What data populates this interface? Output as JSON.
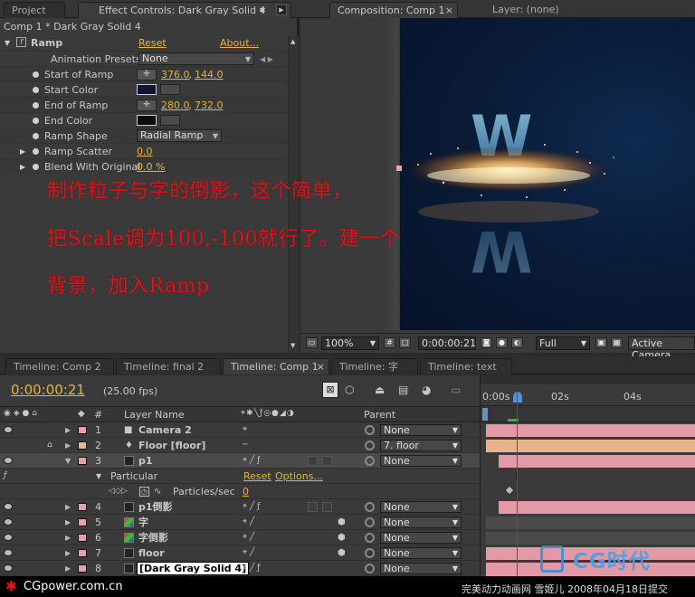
{
  "top_tabs": {
    "project": "Project",
    "effect_controls": "Effect Controls: Dark Gray Solid 4",
    "composition": "Composition: Comp 1",
    "layer": "Layer: (none)"
  },
  "effect_controls": {
    "breadcrumb": "Comp 1 * Dark Gray Solid 4",
    "effect_name": "Ramp",
    "reset": "Reset",
    "about": "About...",
    "presets_label": "Animation Presets:",
    "presets_value": "None",
    "props": [
      {
        "label": "Start of Ramp",
        "value_a": "376.0",
        "sep": " , ",
        "value_b": "144.0"
      },
      {
        "label": "Start Color"
      },
      {
        "label": "End of Ramp",
        "value_a": "280.0",
        "sep": " , ",
        "value_b": "732.0"
      },
      {
        "label": "End Color"
      },
      {
        "label": "Ramp Shape",
        "dropdown": "Radial Ramp"
      },
      {
        "label": "Ramp Scatter",
        "value": "0.0"
      },
      {
        "label": "Blend With Original",
        "value": "0.0 %"
      }
    ]
  },
  "overlay": {
    "line1": "制作粒子与字的倒影，这个简单，",
    "line2": "把Scale调为100,-100就行了。建一个",
    "line3": "背景，加入Ramp"
  },
  "viewer": {
    "zoom": "100%",
    "timecode": "0:00:00:21",
    "resolution": "Full",
    "camera": "Active Camera",
    "canvas_letter": "W"
  },
  "timeline_tabs": [
    "Timeline: Comp 2",
    "Timeline: final 2",
    "Timeline: Comp 1",
    "Timeline: 字",
    "Timeline: text"
  ],
  "timeline": {
    "timecode": "0:00:00:21",
    "fps": "(25.00 fps)",
    "col_num": "#",
    "col_layer": "Layer Name",
    "col_parent": "Parent",
    "ruler": [
      "0:00s",
      "02s",
      "04s"
    ],
    "layers": [
      {
        "num": "1",
        "name": "Camera 2",
        "parent": "None",
        "color": "#e6a0a8"
      },
      {
        "num": "2",
        "name": "Floor [floor]",
        "parent": "7. floor",
        "color": "#e8b68c"
      },
      {
        "num": "3",
        "name": "p1",
        "parent": "None",
        "color": "#e6a0a8"
      },
      {
        "num": "4",
        "name": "p1倒影",
        "parent": "None",
        "color": "#e6a0a8"
      },
      {
        "num": "5",
        "name": "字",
        "parent": "None",
        "color": "#e6a0a8"
      },
      {
        "num": "6",
        "name": "字倒影",
        "parent": "None",
        "color": "#e6a0a8"
      },
      {
        "num": "7",
        "name": "floor",
        "parent": "None",
        "color": "#e6a0a8"
      },
      {
        "num": "8",
        "name": "[Dark Gray Solid 4]",
        "parent": "None",
        "color": "#e6a0a8"
      }
    ],
    "sub_effect": "Particular",
    "sub_reset": "Reset",
    "sub_options": "Options...",
    "sub_prop": "Particles/sec",
    "sub_prop_value": "0"
  },
  "footer": {
    "site": "CGpower.com.cn",
    "credit": "完美动力动画网 雪姬儿 2008年04月18日提交",
    "logo_text": "CG时代"
  },
  "colors": {
    "accent_yellow": "#e3b53c",
    "overlay_red": "#d8141c",
    "bar_pink": "#e39aa6",
    "bar_orange": "#e8b38a"
  }
}
